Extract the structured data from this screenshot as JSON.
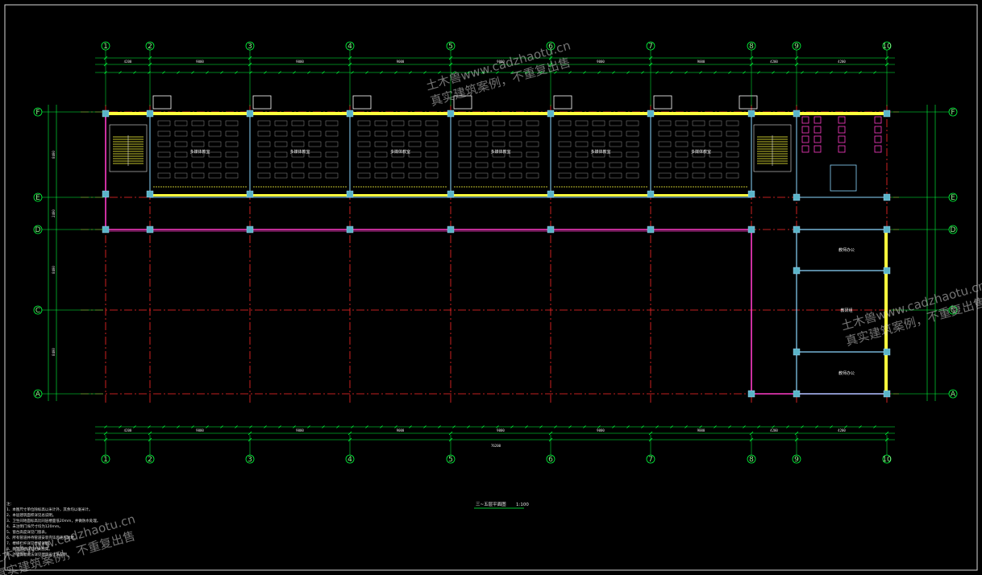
{
  "drawing": {
    "title": "三~五层平面图",
    "scale": "1:100",
    "colors": {
      "background": "#000000",
      "dimension": "#00ff3c",
      "axis": "#ff2a2a",
      "wall": "#ff3cc8",
      "column": "#5ab4c8",
      "window": "#ffff3c",
      "text": "#f0f0f0"
    }
  },
  "axes": {
    "vertical": [
      "1",
      "2",
      "3",
      "4",
      "5",
      "6",
      "7",
      "8",
      "9",
      "10"
    ],
    "horizontal": [
      "F",
      "E",
      "D",
      "C",
      "A"
    ]
  },
  "dimensions": {
    "top_segments": [
      "4200",
      "9000",
      "9000",
      "9000",
      "9000",
      "9000",
      "9000",
      "4200",
      "4200"
    ],
    "bottom_total": "76200",
    "left_segments": [
      "8400",
      "2400",
      "8400",
      "8400"
    ]
  },
  "rooms": {
    "classrooms": [
      "多媒体教室",
      "多媒体教室",
      "多媒体教室",
      "多媒体教室",
      "多媒体教室",
      "多媒体教室"
    ],
    "east_rooms": [
      "教师办公",
      "教研组",
      "教师办公"
    ]
  },
  "watermarks": [
    {
      "line1": "土木兽www.cadzhaotu.cn",
      "line2": "真实建筑案例，不重复出售"
    },
    {
      "line1": "土木兽www.cadzhaotu.cn",
      "line2": "真实建筑案例，不重复出售"
    },
    {
      "line1": "土木兽www.cadzhaotu.cn",
      "line2": "真实建筑案例，不重复出售"
    }
  ],
  "notes": [
    "注：",
    "1、本图尺寸单位除标高以米计外，其余均以毫米计。",
    "2、本层建筑面积详见总说明。",
    "3、卫生间地面标高比同层楼面低20mm，并做防水处理。",
    "4、未注明门垛尺寸均为120mm。",
    "5、窗台高度详见门窗表。",
    "6、所有管道井待管道安装完毕后逐层封堵。",
    "7、楼梯栏杆详见楼梯详图。",
    "8、教室黑板详见相关图集。",
    "9、外墙保温做法详见建筑设计总说明。"
  ]
}
